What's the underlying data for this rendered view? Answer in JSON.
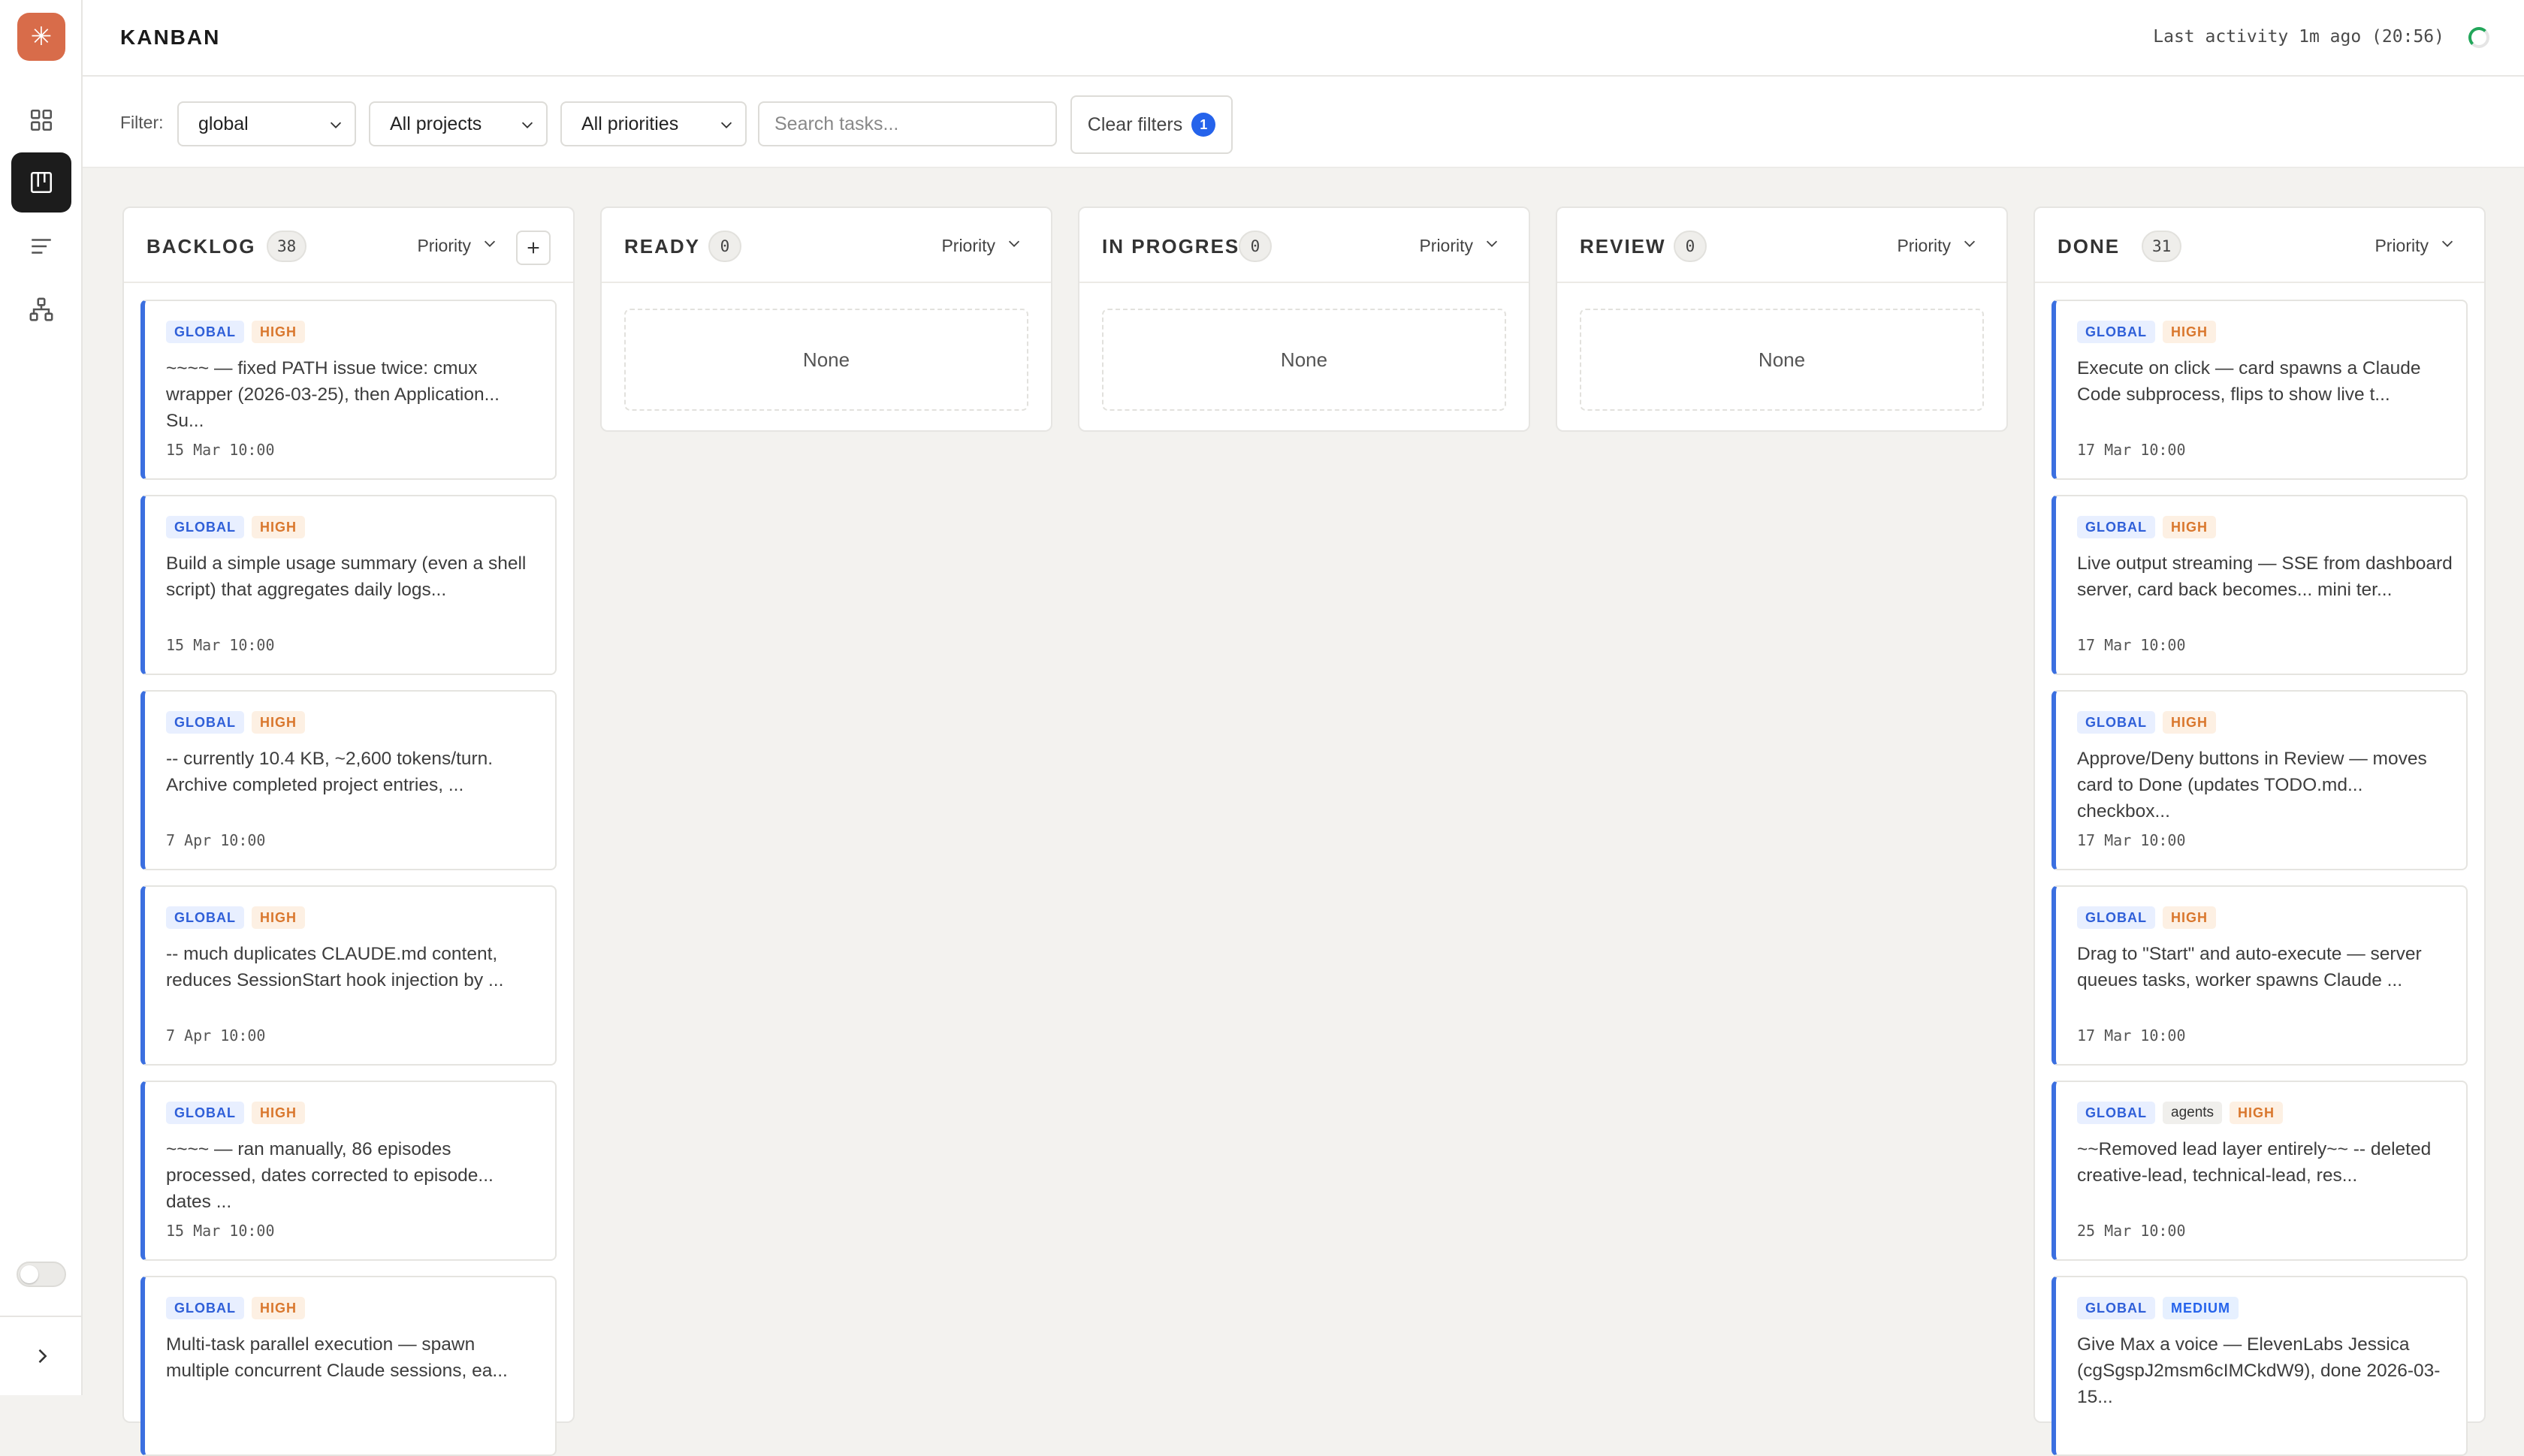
{
  "app": {
    "logo_glyph": "✳",
    "accent": "#d86c4a"
  },
  "sidebar": {
    "items": [
      {
        "name": "dashboard",
        "icon": "grid-icon",
        "active": false
      },
      {
        "name": "kanban",
        "icon": "kanban-icon",
        "active": true
      },
      {
        "name": "list",
        "icon": "list-icon",
        "active": false
      },
      {
        "name": "hierarchy",
        "icon": "hierarchy-icon",
        "active": false
      }
    ]
  },
  "header": {
    "title": "KANBAN",
    "activity": "Last activity 1m ago (20:56)"
  },
  "filters": {
    "label": "Filter:",
    "scope": "global",
    "projects": "All projects",
    "priorities": "All priorities",
    "search_placeholder": "Search tasks...",
    "clear_label": "Clear filters",
    "clear_count": "1"
  },
  "columns": [
    {
      "title": "BACKLOG",
      "count": "38",
      "sort": "Priority",
      "has_add": true,
      "cards": [
        {
          "tags": [
            "GLOBAL",
            "HIGH"
          ],
          "text": "~~~~ — fixed PATH issue twice: cmux wrapper (2026-03-25), then Application... Su...",
          "date": "15 Mar 10:00"
        },
        {
          "tags": [
            "GLOBAL",
            "HIGH"
          ],
          "text": "Build a simple usage summary (even a shell script) that aggregates daily logs...",
          "date": "15 Mar 10:00"
        },
        {
          "tags": [
            "GLOBAL",
            "HIGH"
          ],
          "text": "-- currently 10.4 KB, ~2,600 tokens/turn. Archive completed project entries, ...",
          "date": "7 Apr 10:00"
        },
        {
          "tags": [
            "GLOBAL",
            "HIGH"
          ],
          "text": "-- much duplicates CLAUDE.md content, reduces SessionStart hook injection by ...",
          "date": "7 Apr 10:00"
        },
        {
          "tags": [
            "GLOBAL",
            "HIGH"
          ],
          "text": "~~~~ — ran manually, 86 episodes processed, dates corrected to episode... dates ...",
          "date": "15 Mar 10:00"
        },
        {
          "tags": [
            "GLOBAL",
            "HIGH"
          ],
          "text": "Multi-task parallel execution — spawn multiple concurrent Claude sessions, ea...",
          "date": ""
        }
      ]
    },
    {
      "title": "READY",
      "count": "0",
      "sort": "Priority",
      "has_add": false,
      "empty": "None",
      "cards": []
    },
    {
      "title": "IN PROGRESS",
      "count": "0",
      "sort": "Priority",
      "has_add": false,
      "empty": "None",
      "cards": []
    },
    {
      "title": "REVIEW",
      "count": "0",
      "sort": "Priority",
      "has_add": false,
      "empty": "None",
      "cards": []
    },
    {
      "title": "DONE",
      "count": "31",
      "sort": "Priority",
      "has_add": false,
      "cards": [
        {
          "tags": [
            "GLOBAL",
            "HIGH"
          ],
          "text": "Execute on click — card spawns a Claude Code subprocess, flips to show live t...",
          "date": "17 Mar 10:00"
        },
        {
          "tags": [
            "GLOBAL",
            "HIGH"
          ],
          "text": "Live output streaming — SSE from dashboard server, card back becomes... mini ter...",
          "date": "17 Mar 10:00"
        },
        {
          "tags": [
            "GLOBAL",
            "HIGH"
          ],
          "text": "Approve/Deny buttons in Review — moves card to Done (updates TODO.md... checkbox...",
          "date": "17 Mar 10:00"
        },
        {
          "tags": [
            "GLOBAL",
            "HIGH"
          ],
          "text": "Drag to \"Start\" and auto-execute — server queues tasks, worker spawns Claude ...",
          "date": "17 Mar 10:00"
        },
        {
          "tags": [
            "GLOBAL",
            "agents",
            "HIGH"
          ],
          "text": "~~Removed lead layer entirely~~ -- deleted creative-lead, technical-lead, res...",
          "date": "25 Mar 10:00"
        },
        {
          "tags": [
            "GLOBAL",
            "MEDIUM"
          ],
          "text": "Give Max a voice — ElevenLabs Jessica (cgSgspJ2msm6cIMCkdW9), done 2026-03-15...",
          "date": ""
        }
      ]
    }
  ]
}
